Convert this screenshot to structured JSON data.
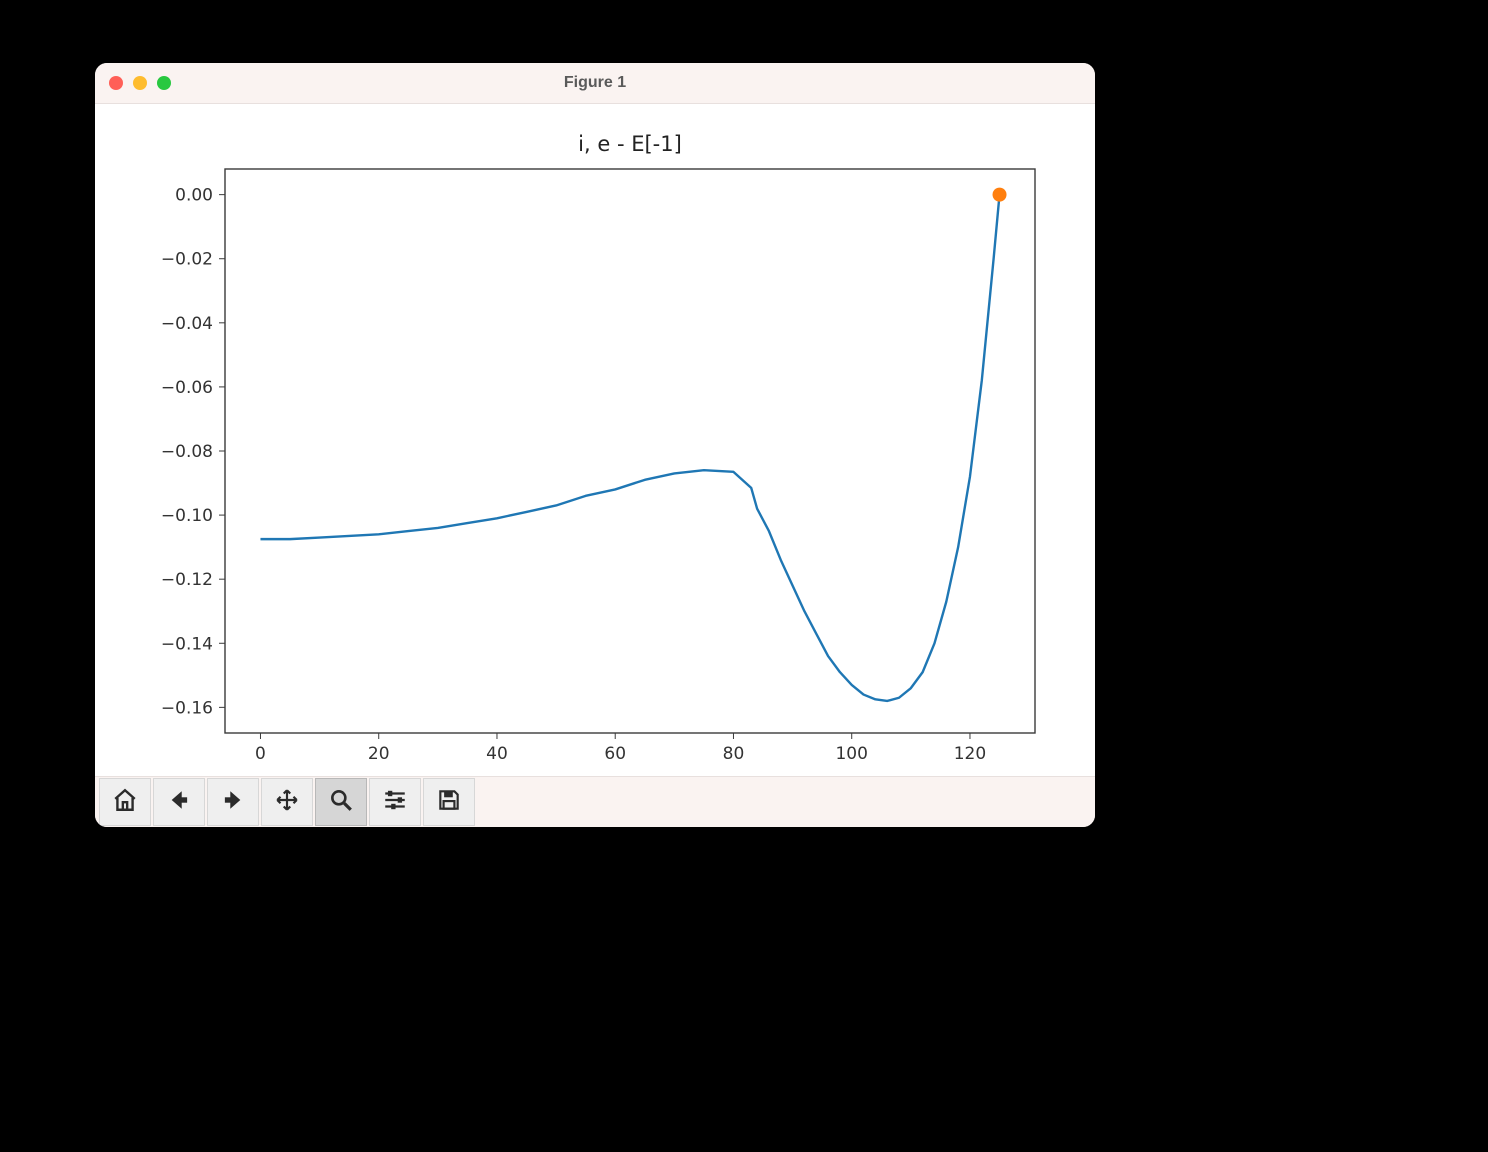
{
  "window": {
    "title": "Figure 1"
  },
  "toolbar": {
    "home": "Home",
    "back": "Back",
    "forward": "Forward",
    "pan": "Pan",
    "zoom": "Zoom",
    "configure": "Configure",
    "save": "Save",
    "active": "zoom"
  },
  "chart_data": {
    "type": "line",
    "title": "i, e - E[-1]",
    "xlabel": "",
    "ylabel": "",
    "xlim": [
      -6,
      131
    ],
    "ylim": [
      -0.168,
      0.008
    ],
    "xticks": [
      0,
      20,
      40,
      60,
      80,
      100,
      120
    ],
    "yticks": [
      0.0,
      -0.02,
      -0.04,
      -0.06,
      -0.08,
      -0.1,
      -0.12,
      -0.14,
      -0.16
    ],
    "ytick_labels": [
      "0.00",
      "−0.02",
      "−0.04",
      "−0.06",
      "−0.08",
      "−0.10",
      "−0.12",
      "−0.14",
      "−0.16"
    ],
    "series": [
      {
        "name": "line",
        "type": "line",
        "color": "#1f77b4",
        "x": [
          0,
          5,
          10,
          15,
          20,
          25,
          30,
          35,
          40,
          45,
          50,
          55,
          60,
          65,
          70,
          75,
          80,
          83,
          84,
          86,
          88,
          90,
          92,
          94,
          96,
          98,
          100,
          102,
          104,
          106,
          108,
          110,
          112,
          114,
          116,
          118,
          120,
          122,
          124,
          125
        ],
        "y": [
          -0.1075,
          -0.1075,
          -0.107,
          -0.1065,
          -0.106,
          -0.105,
          -0.104,
          -0.1025,
          -0.101,
          -0.099,
          -0.097,
          -0.094,
          -0.092,
          -0.089,
          -0.087,
          -0.086,
          -0.0865,
          -0.0915,
          -0.098,
          -0.105,
          -0.114,
          -0.122,
          -0.13,
          -0.137,
          -0.144,
          -0.149,
          -0.153,
          -0.156,
          -0.1575,
          -0.158,
          -0.157,
          -0.154,
          -0.149,
          -0.14,
          -0.127,
          -0.11,
          -0.088,
          -0.058,
          -0.02,
          0.0
        ]
      },
      {
        "name": "marker",
        "type": "scatter",
        "color": "#ff7f0e",
        "x": [
          125
        ],
        "y": [
          0.0
        ]
      }
    ]
  }
}
